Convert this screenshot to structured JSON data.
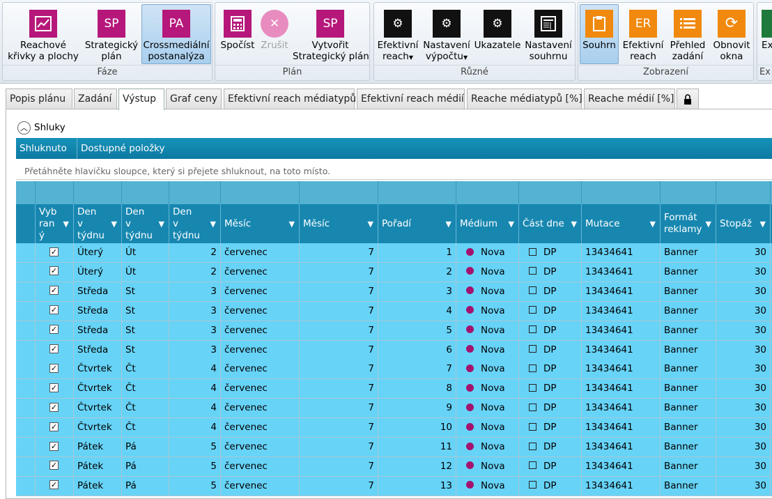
{
  "ribbon": {
    "groups": [
      {
        "label": "Fáze"
      },
      {
        "label": "Plán"
      },
      {
        "label": "Různé"
      },
      {
        "label": "Zobrazení"
      },
      {
        "label": "Ex"
      }
    ],
    "buttons": {
      "reach_curves": {
        "l1": "Reachové",
        "l2": "křivky a plochy",
        "icon": "line-chart-icon"
      },
      "strategic_plan": {
        "l1": "Strategický",
        "l2": "plán",
        "icon_text": "SP"
      },
      "crossmedia": {
        "l1": "Crossmediální",
        "l2": "postanalýza",
        "icon_text": "PA"
      },
      "calculate": {
        "l1": "Spočíst",
        "icon": "calculator-icon"
      },
      "cancel": {
        "l1": "Zrušit",
        "icon": "cancel-icon"
      },
      "create_sp": {
        "l1": "Vytvořit",
        "l2": "Strategický plán",
        "icon_text": "SP"
      },
      "eff_reach": {
        "l1": "Efektivní",
        "l2": "reach",
        "icon": "gear-icon"
      },
      "calc_settings": {
        "l1": "Nastavení",
        "l2": "výpočtu",
        "icon": "gear-icon"
      },
      "indicators": {
        "l1": "Ukazatele",
        "icon": "gear-icon"
      },
      "summary_settings": {
        "l1": "Nastavení",
        "l2": "souhrnu",
        "icon": "document-icon"
      },
      "summary": {
        "l1": "Souhrn",
        "icon": "clipboard-icon"
      },
      "er_view": {
        "l1": "Efektivní",
        "l2": "reach",
        "icon_text": "ER"
      },
      "overview": {
        "l1": "Přehled",
        "l2": "zadání",
        "icon": "list-icon"
      },
      "refresh": {
        "l1": "Obnovit",
        "l2": "okna",
        "icon": "refresh-icon"
      },
      "ex": {
        "l1": "Ex"
      }
    }
  },
  "tabs": [
    "Popis plánu",
    "Zadání",
    "Výstup",
    "Graf ceny",
    "Efektivní reach médiatypů",
    "Efektivní reach médií",
    "Reache médiatypů [%]",
    "Reache médií [%]"
  ],
  "lock_icon": "lock-icon",
  "clusters_label": "Shluky",
  "group_header": {
    "col1": "Shluknuto po",
    "col2": "Dostupné položky"
  },
  "drag_hint": "Přetáhněte hlavičku sloupce, který si přejete shluknout, na toto místo.",
  "columns": [
    {
      "key": "sel",
      "label": "Vyb ran ý"
    },
    {
      "key": "day",
      "label": "Den v týdnu"
    },
    {
      "key": "dayshort",
      "label": "Den v týdnu"
    },
    {
      "key": "daynum",
      "label": "Den v týdnu"
    },
    {
      "key": "month",
      "label": "Měsíc"
    },
    {
      "key": "monthnum",
      "label": "Měsíc"
    },
    {
      "key": "order",
      "label": "Pořadí"
    },
    {
      "key": "medium",
      "label": "Médium"
    },
    {
      "key": "part",
      "label": "Část dne"
    },
    {
      "key": "mutation",
      "label": "Mutace"
    },
    {
      "key": "format",
      "label": "Formát reklamy"
    },
    {
      "key": "stopaz",
      "label": "Stopáž"
    }
  ],
  "rows": [
    {
      "day": "Úterý",
      "dayshort": "Út",
      "daynum": "2",
      "month": "červenec",
      "monthnum": "7",
      "order": "1",
      "medium": "Nova",
      "part": "DP",
      "mutation": "13434641",
      "format": "Banner",
      "stopaz": "30"
    },
    {
      "day": "Úterý",
      "dayshort": "Út",
      "daynum": "2",
      "month": "červenec",
      "monthnum": "7",
      "order": "2",
      "medium": "Nova",
      "part": "DP",
      "mutation": "13434641",
      "format": "Banner",
      "stopaz": "30"
    },
    {
      "day": "Středa",
      "dayshort": "St",
      "daynum": "3",
      "month": "červenec",
      "monthnum": "7",
      "order": "3",
      "medium": "Nova",
      "part": "DP",
      "mutation": "13434641",
      "format": "Banner",
      "stopaz": "30"
    },
    {
      "day": "Středa",
      "dayshort": "St",
      "daynum": "3",
      "month": "červenec",
      "monthnum": "7",
      "order": "4",
      "medium": "Nova",
      "part": "DP",
      "mutation": "13434641",
      "format": "Banner",
      "stopaz": "30"
    },
    {
      "day": "Středa",
      "dayshort": "St",
      "daynum": "3",
      "month": "červenec",
      "monthnum": "7",
      "order": "5",
      "medium": "Nova",
      "part": "DP",
      "mutation": "13434641",
      "format": "Banner",
      "stopaz": "30"
    },
    {
      "day": "Středa",
      "dayshort": "St",
      "daynum": "3",
      "month": "červenec",
      "monthnum": "7",
      "order": "6",
      "medium": "Nova",
      "part": "DP",
      "mutation": "13434641",
      "format": "Banner",
      "stopaz": "30"
    },
    {
      "day": "Čtvrtek",
      "dayshort": "Čt",
      "daynum": "4",
      "month": "červenec",
      "monthnum": "7",
      "order": "7",
      "medium": "Nova",
      "part": "DP",
      "mutation": "13434641",
      "format": "Banner",
      "stopaz": "30"
    },
    {
      "day": "Čtvrtek",
      "dayshort": "Čt",
      "daynum": "4",
      "month": "červenec",
      "monthnum": "7",
      "order": "8",
      "medium": "Nova",
      "part": "DP",
      "mutation": "13434641",
      "format": "Banner",
      "stopaz": "30"
    },
    {
      "day": "Čtvrtek",
      "dayshort": "Čt",
      "daynum": "4",
      "month": "červenec",
      "monthnum": "7",
      "order": "9",
      "medium": "Nova",
      "part": "DP",
      "mutation": "13434641",
      "format": "Banner",
      "stopaz": "30"
    },
    {
      "day": "Čtvrtek",
      "dayshort": "Čt",
      "daynum": "4",
      "month": "červenec",
      "monthnum": "7",
      "order": "10",
      "medium": "Nova",
      "part": "DP",
      "mutation": "13434641",
      "format": "Banner",
      "stopaz": "30"
    },
    {
      "day": "Pátek",
      "dayshort": "Pá",
      "daynum": "5",
      "month": "červenec",
      "monthnum": "7",
      "order": "11",
      "medium": "Nova",
      "part": "DP",
      "mutation": "13434641",
      "format": "Banner",
      "stopaz": "30"
    },
    {
      "day": "Pátek",
      "dayshort": "Pá",
      "daynum": "5",
      "month": "červenec",
      "monthnum": "7",
      "order": "12",
      "medium": "Nova",
      "part": "DP",
      "mutation": "13434641",
      "format": "Banner",
      "stopaz": "30"
    },
    {
      "day": "Pátek",
      "dayshort": "Pá",
      "daynum": "5",
      "month": "červenec",
      "monthnum": "7",
      "order": "13",
      "medium": "Nova",
      "part": "DP",
      "mutation": "13434641",
      "format": "Banner",
      "stopaz": "30"
    }
  ],
  "colors": {
    "row_bg": "#67d3f7",
    "header_bg": "#1787b0",
    "medium_dot": "#a4126e",
    "brand_magenta": "#b5187a",
    "accent_orange": "#f0890e"
  }
}
